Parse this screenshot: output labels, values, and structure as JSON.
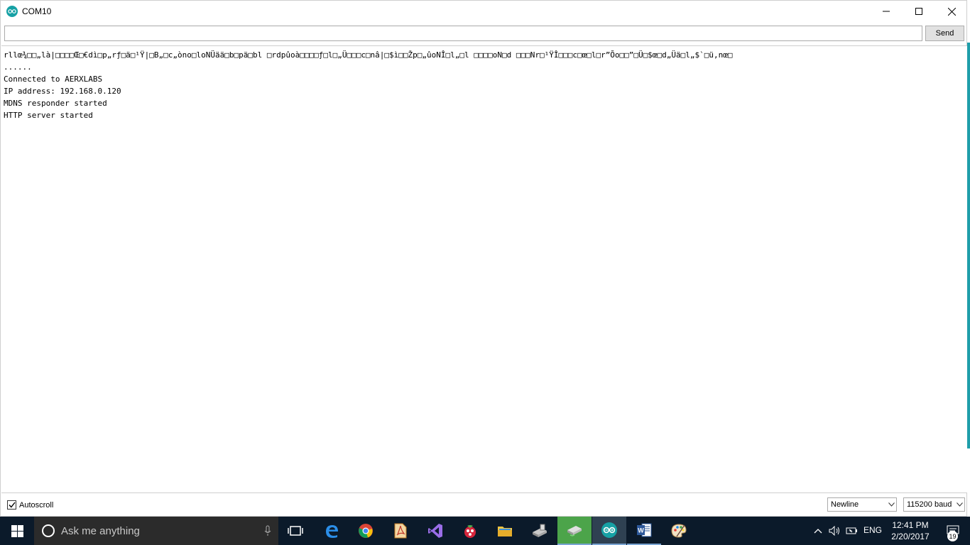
{
  "window": {
    "title": "COM10"
  },
  "send": {
    "input_value": "",
    "button_label": "Send"
  },
  "output": {
    "lines": [
      "rllœ¾□□„là|□□□□Œ□€dì□p„rƒ□ä□¹Ÿ|□B„□c„òno□loNÜää□b□pä□bl □rdpûoà□□□□ƒ□l□„Ü□□□c□nâ|□$ì□□Žp□„ûoNÎ□l„□l □□□□oN□d □□□Nr□¹ŸÎ□□□c□œ□l□r”Õo□□”□Ü□$œ□d„Üä□l„$`□ü,nœ□",
      "......",
      "Connected to AERXLABS",
      "IP address: 192.168.0.120",
      "MDNS responder started",
      "HTTP server started"
    ]
  },
  "bottom": {
    "autoscroll_label": "Autoscroll",
    "autoscroll_checked": true,
    "line_ending": "Newline",
    "baud": "115200 baud"
  },
  "taskbar": {
    "search_placeholder": "Ask me anything",
    "language": "ENG",
    "time": "12:41 PM",
    "date": "2/20/2017",
    "notification_count": "19"
  },
  "colors": {
    "arduino_teal": "#17a1a5",
    "taskbar_bg": "#0b1a2a"
  }
}
